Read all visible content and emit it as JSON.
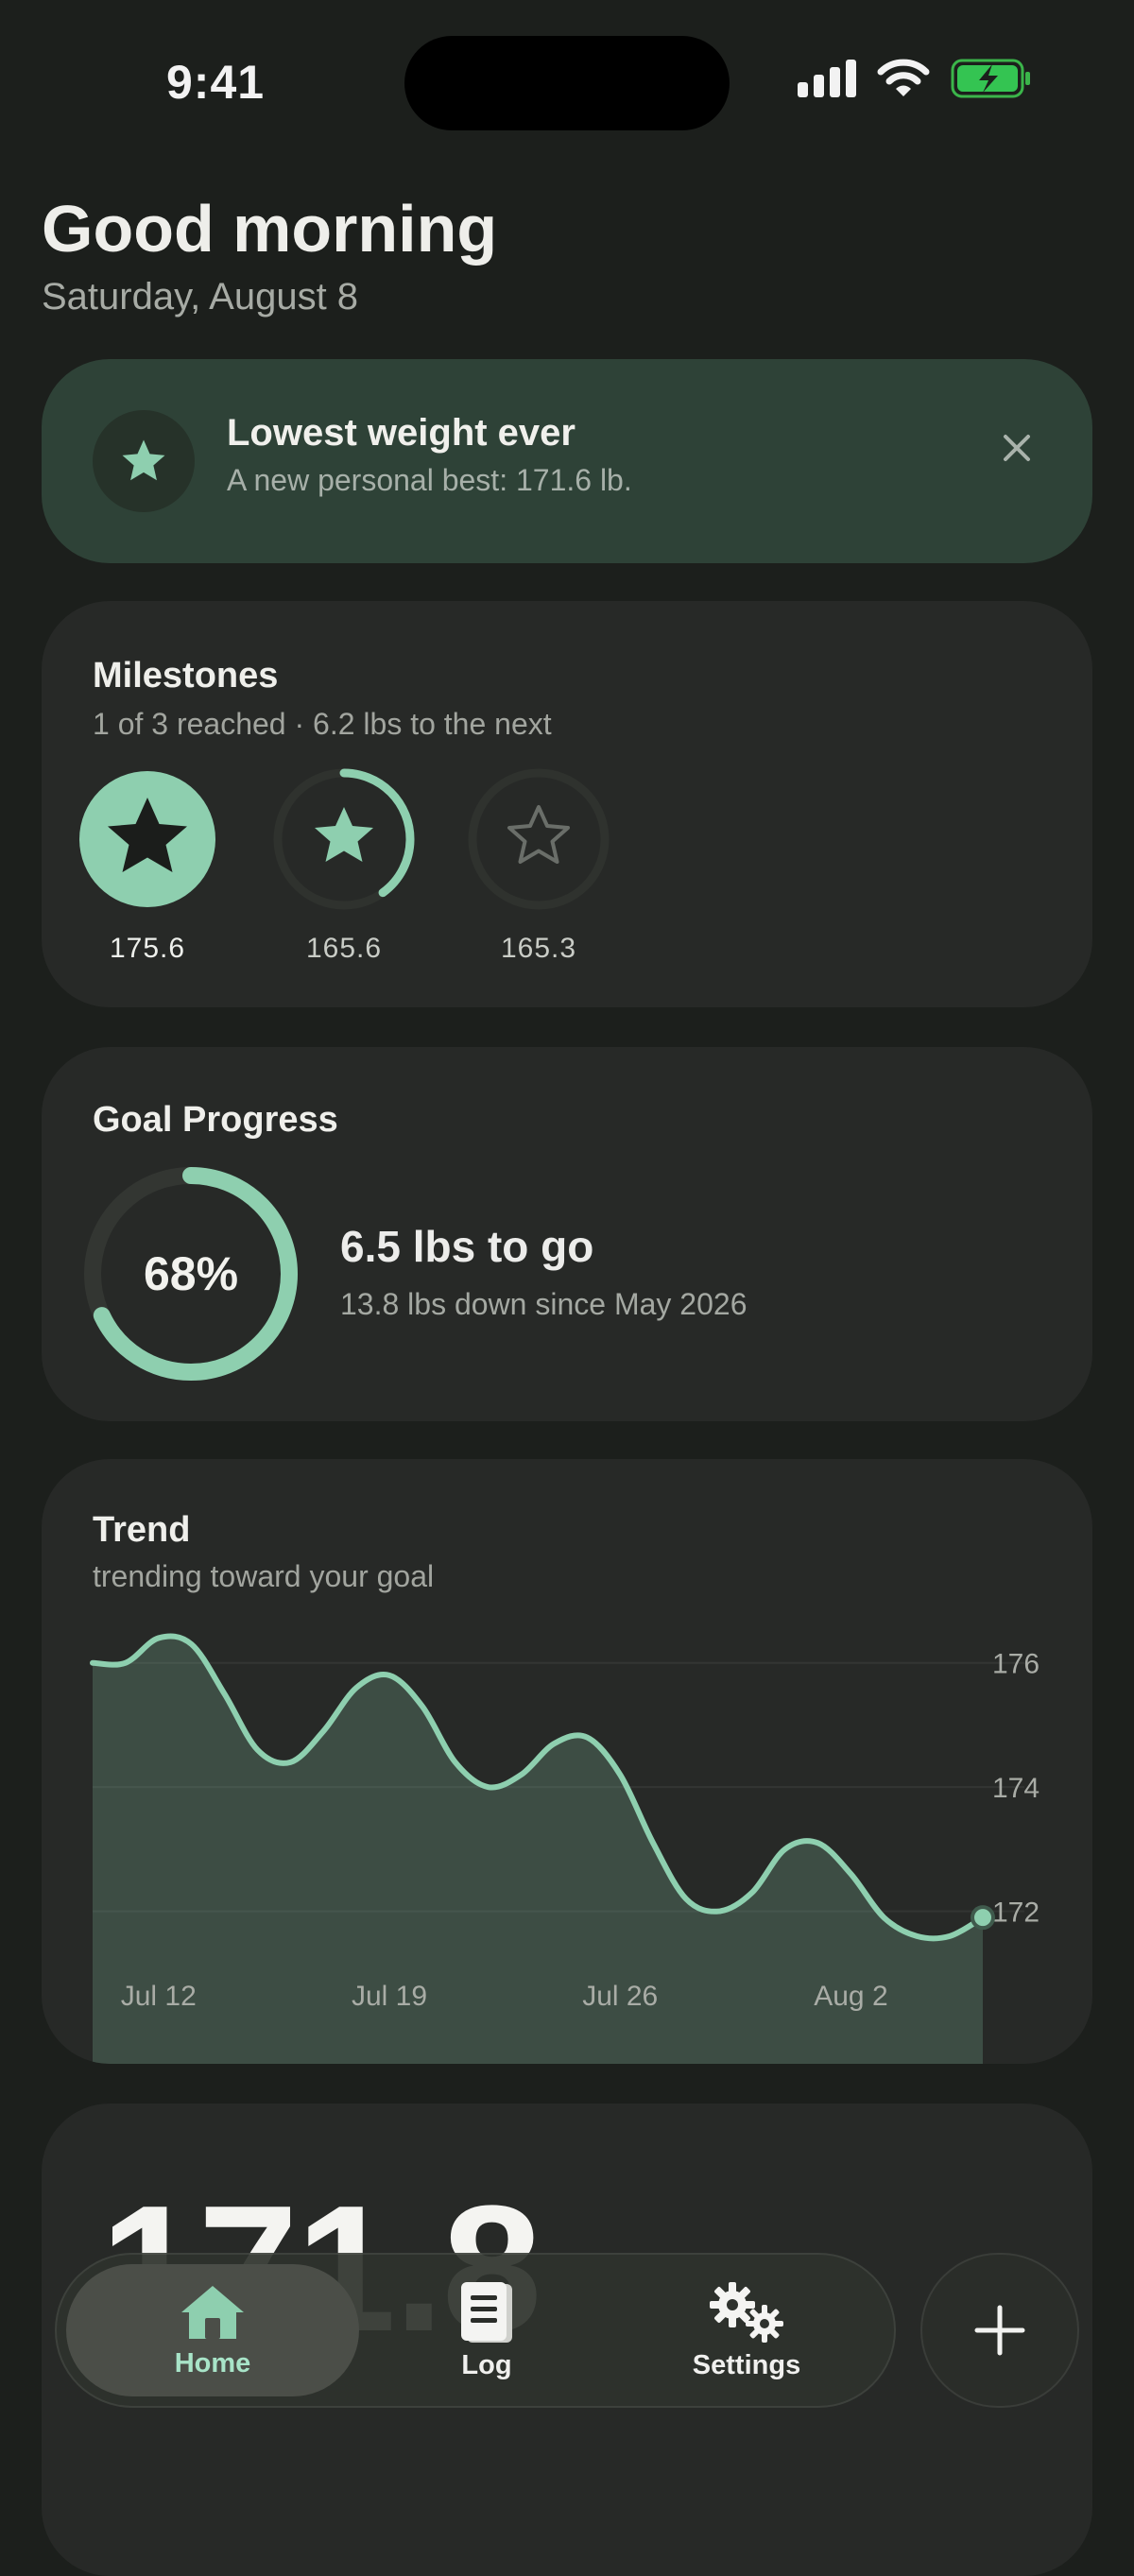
{
  "status_bar": {
    "time": "9:41"
  },
  "header": {
    "greeting": "Good morning",
    "date": "Saturday, August 8"
  },
  "banner": {
    "title": "Lowest weight ever",
    "subtitle": "A new personal best: 171.6 lb.",
    "icon": "star-icon",
    "close_icon": "close-icon"
  },
  "milestones": {
    "title": "Milestones",
    "subtitle": "1 of 3 reached · 6.2 lbs to the next",
    "items": [
      {
        "label": "175.6",
        "state": "reached"
      },
      {
        "label": "165.6",
        "state": "in-progress",
        "progress": 0.4
      },
      {
        "label": "165.3",
        "state": "locked"
      }
    ]
  },
  "goal": {
    "title": "Goal Progress",
    "percent_label": "68%",
    "percent": 0.68,
    "main": "6.5 lbs to go",
    "sub": "13.8 lbs down since May 2026"
  },
  "trend": {
    "title": "Trend",
    "subtitle": "trending toward your goal"
  },
  "chart_data": {
    "type": "area",
    "x": [
      "Jul 10",
      "Jul 11",
      "Jul 12",
      "Jul 13",
      "Jul 14",
      "Jul 15",
      "Jul 16",
      "Jul 17",
      "Jul 18",
      "Jul 19",
      "Jul 20",
      "Jul 21",
      "Jul 22",
      "Jul 23",
      "Jul 24",
      "Jul 25",
      "Jul 26",
      "Jul 27",
      "Jul 28",
      "Jul 29",
      "Jul 30",
      "Jul 31",
      "Aug 1",
      "Aug 2",
      "Aug 3",
      "Aug 4",
      "Aug 5",
      "Aug 6",
      "Aug 7",
      "Aug 8"
    ],
    "values": [
      176.0,
      176.0,
      176.4,
      176.3,
      175.5,
      174.6,
      174.4,
      174.9,
      175.6,
      175.8,
      175.3,
      174.4,
      174.0,
      174.2,
      174.7,
      174.8,
      174.2,
      173.1,
      172.2,
      172.0,
      172.3,
      173.0,
      173.1,
      172.6,
      171.9,
      171.6,
      171.6,
      171.9
    ],
    "x_ticks": [
      "Jul 12",
      "Jul 19",
      "Jul 26",
      "Aug 2"
    ],
    "y_ticks": [
      "176",
      "174",
      "172"
    ],
    "ylim": [
      170.0,
      177.0
    ],
    "grid": true,
    "color": "#8ecfaf"
  },
  "weight_card": {
    "value": "171.8"
  },
  "tabbar": {
    "tabs": [
      {
        "label": "Home",
        "icon": "house-icon",
        "active": true
      },
      {
        "label": "Log",
        "icon": "journal-icon",
        "active": false
      },
      {
        "label": "Settings",
        "icon": "gears-icon",
        "active": false
      }
    ],
    "add_icon": "plus-icon"
  },
  "colors": {
    "accent": "#8ecfaf",
    "background": "#1c1f1c",
    "card": "#272927",
    "banner": "#2e4237"
  }
}
